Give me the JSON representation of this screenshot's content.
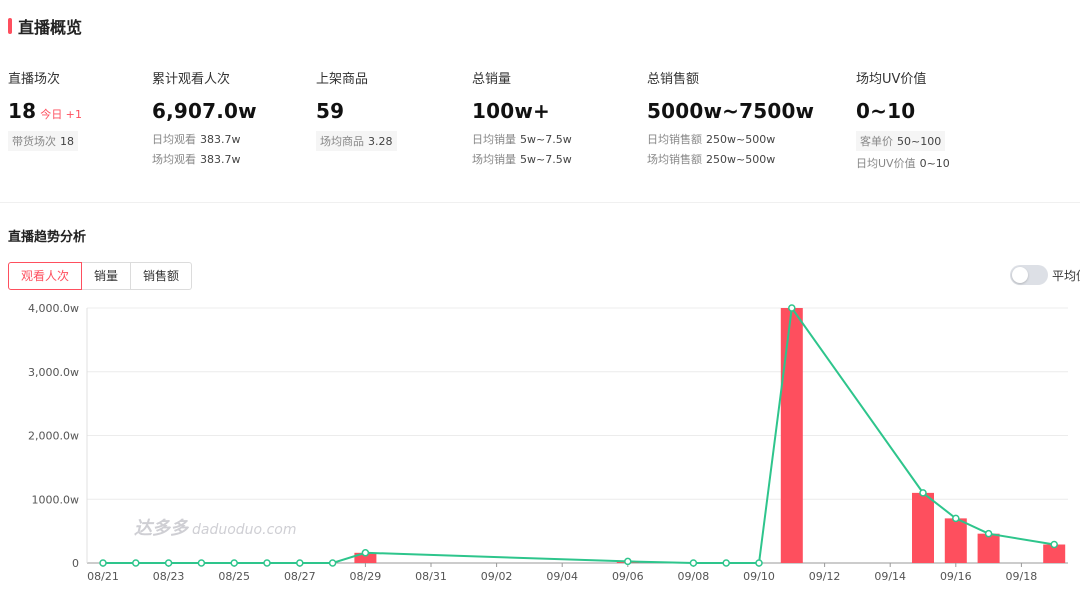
{
  "header": {
    "title": "直播概览",
    "accent": "#fe4f5e"
  },
  "stats": {
    "sessions": {
      "label": "直播场次",
      "value": "18",
      "today_label": "今日",
      "today_value": "+1",
      "tag_label": "带货场次",
      "tag_value": "18"
    },
    "viewers": {
      "label": "累计观看人次",
      "value": "6,907.0w",
      "line1_label": "日均观看",
      "line1_value": "383.7w",
      "line2_label": "场均观看",
      "line2_value": "383.7w"
    },
    "products": {
      "label": "上架商品",
      "value": "59",
      "tag_label": "场均商品",
      "tag_value": "3.28"
    },
    "sales": {
      "label": "总销量",
      "value": "100w+",
      "line1_label": "日均销量",
      "line1_value": "5w~7.5w",
      "line2_label": "场均销量",
      "line2_value": "5w~7.5w"
    },
    "revenue": {
      "label": "总销售额",
      "value": "5000w~7500w",
      "line1_label": "日均销售额",
      "line1_value": "250w~500w",
      "line2_label": "场均销售额",
      "line2_value": "250w~500w"
    },
    "uv": {
      "label": "场均UV价值",
      "value": "0~10",
      "tag_label": "客单价",
      "tag_value": "50~100",
      "line2_label": "日均UV价值",
      "line2_value": "0~10"
    }
  },
  "trend": {
    "title": "直播趋势分析",
    "tabs": [
      "观看人次",
      "销量",
      "销售额"
    ],
    "active_tab": "观看人次",
    "toggle_label": "平均值"
  },
  "watermark": {
    "brand": "达多多",
    "site": "daduoduo.com"
  },
  "chart_data": {
    "type": "bar",
    "bar_color": "#fe4f5e",
    "line_color": "#2ec58c",
    "ylim": [
      0,
      4000
    ],
    "yticks": [
      "0",
      "1000.0w",
      "2,000.0w",
      "3,000.0w",
      "4,000.0w"
    ],
    "ytick_values": [
      0,
      1000,
      2000,
      3000,
      4000
    ],
    "xticks": [
      "08/21",
      "08/23",
      "08/25",
      "08/27",
      "08/29",
      "08/31",
      "09/02",
      "09/04",
      "09/06",
      "09/08",
      "09/10",
      "09/12",
      "09/14",
      "09/16",
      "09/18"
    ],
    "bars": [
      {
        "date": "08/29",
        "value": 160
      },
      {
        "date": "09/06",
        "value": 25
      },
      {
        "date": "09/11",
        "value": 4000
      },
      {
        "date": "09/15",
        "value": 1100
      },
      {
        "date": "09/16",
        "value": 700
      },
      {
        "date": "09/17",
        "value": 460
      },
      {
        "date": "09/19",
        "value": 290
      }
    ],
    "line": [
      {
        "date": "08/21",
        "value": 0
      },
      {
        "date": "08/22",
        "value": 0
      },
      {
        "date": "08/23",
        "value": 0
      },
      {
        "date": "08/24",
        "value": 0
      },
      {
        "date": "08/25",
        "value": 0
      },
      {
        "date": "08/26",
        "value": 0
      },
      {
        "date": "08/27",
        "value": 0
      },
      {
        "date": "08/28",
        "value": 0
      },
      {
        "date": "08/29",
        "value": 160
      },
      {
        "date": "09/06",
        "value": 25
      },
      {
        "date": "09/08",
        "value": 0
      },
      {
        "date": "09/09",
        "value": 0
      },
      {
        "date": "09/10",
        "value": 0
      },
      {
        "date": "09/11",
        "value": 4000
      },
      {
        "date": "09/15",
        "value": 1100
      },
      {
        "date": "09/16",
        "value": 700
      },
      {
        "date": "09/17",
        "value": 460
      },
      {
        "date": "09/19",
        "value": 290
      }
    ]
  }
}
